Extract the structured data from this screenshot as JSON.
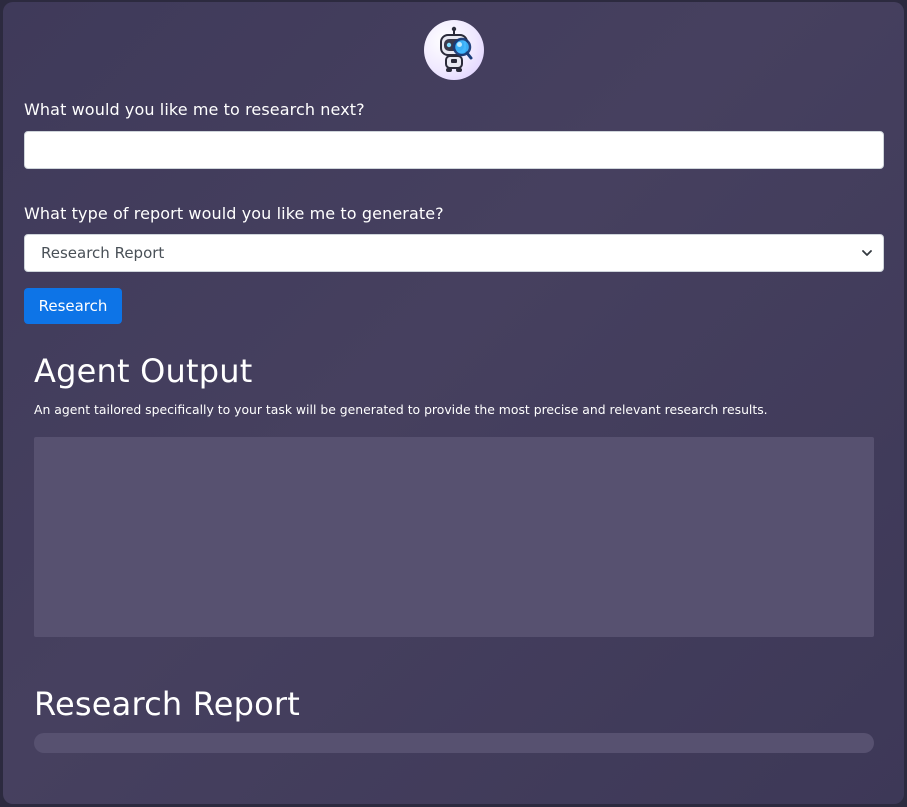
{
  "logo": {
    "icon": "robot-detective-icon"
  },
  "query": {
    "label": "What would you like me to research next?",
    "value": "",
    "placeholder": ""
  },
  "report_type": {
    "label": "What type of report would you like me to generate?",
    "selected": "Research Report"
  },
  "research_button": {
    "label": "Research"
  },
  "agent_output": {
    "title": "Agent Output",
    "description": "An agent tailored specifically to your task will be generated to provide the most precise and relevant research results."
  },
  "report": {
    "title": "Research Report"
  },
  "colors": {
    "accent": "#0d74e7",
    "panel": "#433d5c",
    "output_box": "#575170"
  }
}
